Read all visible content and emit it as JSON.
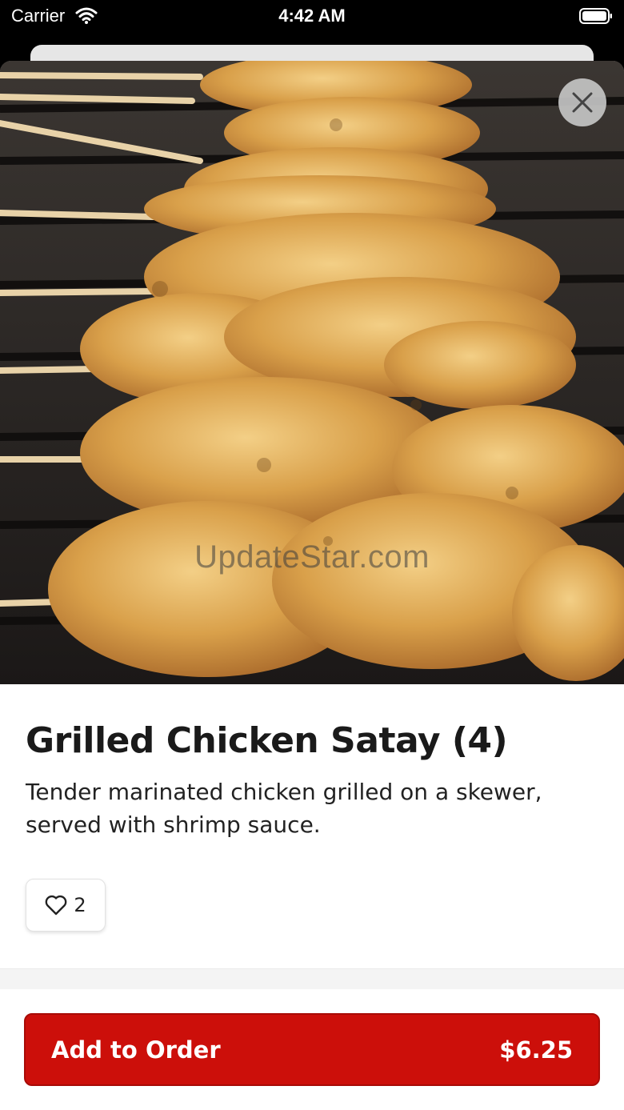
{
  "status_bar": {
    "carrier": "Carrier",
    "time": "4:42 AM",
    "wifi_icon": "wifi-icon",
    "battery_icon": "battery-icon"
  },
  "hero": {
    "image": "grilled-chicken-satay-skewers-photo",
    "watermark": "UpdateStar.com",
    "close_icon": "close-icon"
  },
  "item": {
    "title": "Grilled Chicken Satay (4)",
    "description": "Tender marinated chicken grilled on a skewer, served with shrimp sauce.",
    "like_count": "2",
    "like_icon": "heart-outline-icon"
  },
  "order_button": {
    "label": "Add to Order",
    "price": "$6.25",
    "color": "#cc0f0a"
  }
}
